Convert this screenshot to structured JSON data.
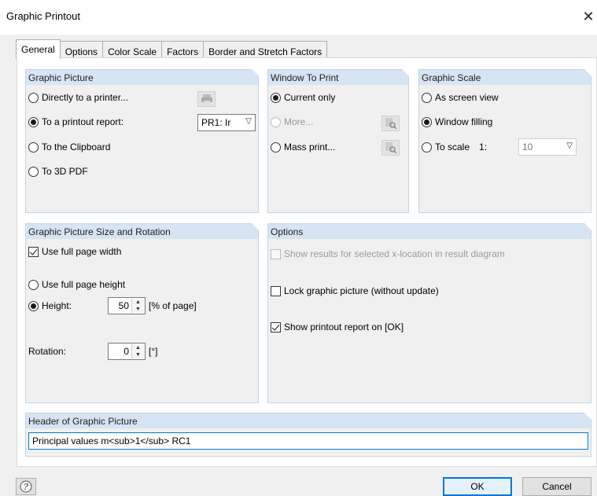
{
  "window": {
    "title": "Graphic Printout",
    "close_glyph": "✕"
  },
  "tabs": [
    "General",
    "Options",
    "Color Scale",
    "Factors",
    "Border and Stretch Factors"
  ],
  "graphic_picture": {
    "title": "Graphic Picture",
    "directly": "Directly to a printer...",
    "report": "To a printout report:",
    "report_select": "PR1: Ir",
    "clipboard": "To the Clipboard",
    "pdf": "To 3D PDF"
  },
  "window_to_print": {
    "title": "Window To Print",
    "current": "Current only",
    "more": "More...",
    "mass": "Mass print..."
  },
  "graphic_scale": {
    "title": "Graphic Scale",
    "screen": "As screen view",
    "filling": "Window filling",
    "to_scale": "To scale",
    "ratio_prefix": "1:",
    "scale_value": "10"
  },
  "size_rotation": {
    "title": "Graphic Picture Size and Rotation",
    "full_width": "Use full page width",
    "full_height": "Use full page height",
    "height_label": "Height:",
    "height_value": "50",
    "height_unit": "[% of page]",
    "rotation_label": "Rotation:",
    "rotation_value": "0",
    "rotation_unit": "[°]"
  },
  "options": {
    "title": "Options",
    "show_results": "Show results for selected x-location in result diagram",
    "lock": "Lock graphic picture (without update)",
    "show_report": "Show printout report on [OK]"
  },
  "header": {
    "title": "Header of Graphic Picture",
    "value": "Principal values m<sub>1</sub> RC1"
  },
  "buttons": {
    "ok": "OK",
    "cancel": "Cancel"
  },
  "icons": {
    "help": "help-icon",
    "printer": "printer-icon",
    "preview": "preview-icon"
  }
}
